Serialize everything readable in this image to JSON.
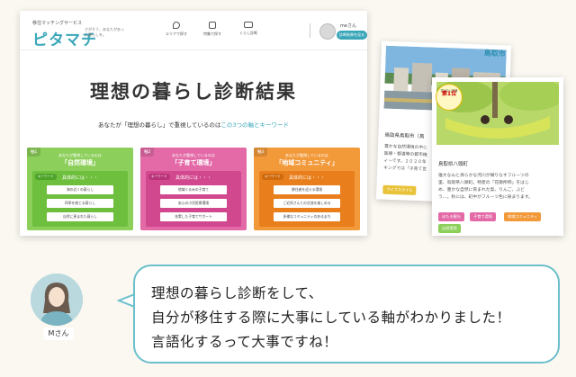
{
  "screenshot": {
    "logo_small": "移住マッチングサービス",
    "logo_main": "ピタマチ",
    "logo_tagline": "さがそう、あなたがあった暮らしを。",
    "nav": [
      {
        "label": "エリアで探す",
        "icon": "map-pin-icon"
      },
      {
        "label": "特集で探す",
        "icon": "flag-icon"
      },
      {
        "label": "くらし診断",
        "icon": "card-icon"
      }
    ],
    "user_name": "meさん",
    "result_button": "診断結果を見る",
    "title": "理想の暮らし診断結果",
    "subtitle_pre": "あなたが「理想の暮らし」で重視しているのは",
    "subtitle_hl": "この3つの軸とキーワード",
    "axes": [
      {
        "tag": "軸1",
        "small": "あなたが重視しているのは",
        "name": "「自然環境」",
        "kw_label": "キーワード",
        "kw_title": "具体的には・・・",
        "items": [
          "海の近くの暮らし",
          "四季を感じる暮らし",
          "自然に恵まれた暮らし"
        ],
        "color": "#8ccf5a",
        "inner": "#6fbf3e",
        "kwbg": "#4ea32a"
      },
      {
        "tag": "軸2",
        "small": "あなたが重視しているのは",
        "name": "「子育て環境」",
        "kw_label": "キーワード",
        "kw_title": "具体的には・・・",
        "items": [
          "地域ぐるみの子育て",
          "安心の小児医療環境",
          "充実した子育てサポート"
        ],
        "color": "#e36aa7",
        "inner": "#d2488f",
        "kwbg": "#b93479"
      },
      {
        "tag": "軸3",
        "small": "あなたが重視しているのは",
        "name": "「地域コミュニティ」",
        "kw_label": "キーワード",
        "kw_title": "具体的には・・・",
        "items": [
          "移住者を迎える環境",
          "ご近所さんとの交流を楽しめる",
          "多様なコミュニティのあるまち"
        ],
        "color": "#f2993a",
        "inner": "#e87f1c",
        "kwbg": "#cf6a0d"
      }
    ]
  },
  "card1": {
    "header": "鳥取市",
    "location": "鳥取県鳥取市（鳥",
    "desc": [
      "豊かな自然環境の中に",
      "医療・都道等の都市機",
      "ィーです。２０２０年",
      "キングでは「子育て世"
    ],
    "tags": [
      {
        "label": "ライフスタイル",
        "color": "#e8c33a"
      }
    ]
  },
  "card2": {
    "badge_top": "住みたい田舎",
    "badge_num": "第1位",
    "location": "鳥取県八頭町",
    "desc": [
      "雄大な山と清らかな河川が織りなすフルーツの",
      "里、鳥取県八頭町。特産の「花御所柿」をはじ",
      "め、豊かな自然に育まれた梨、りんご、ぶど",
      "う…。秋には、町中がフルーツ色に染まります。"
    ],
    "tags": [
      {
        "label": "ほたる観光",
        "color": "#e36aa7"
      },
      {
        "label": "子育て環境",
        "color": "#e36aa7"
      },
      {
        "label": "地域コミュニティ",
        "color": "#f2993a"
      },
      {
        "label": "自然環境",
        "color": "#8ccf5a"
      }
    ]
  },
  "speaker": "Mさん",
  "speech_lines": [
    "理想の暮らし診断をして、",
    "自分が移住する際に大事にしている軸がわかりました！",
    "言語化するって大事ですね！"
  ]
}
